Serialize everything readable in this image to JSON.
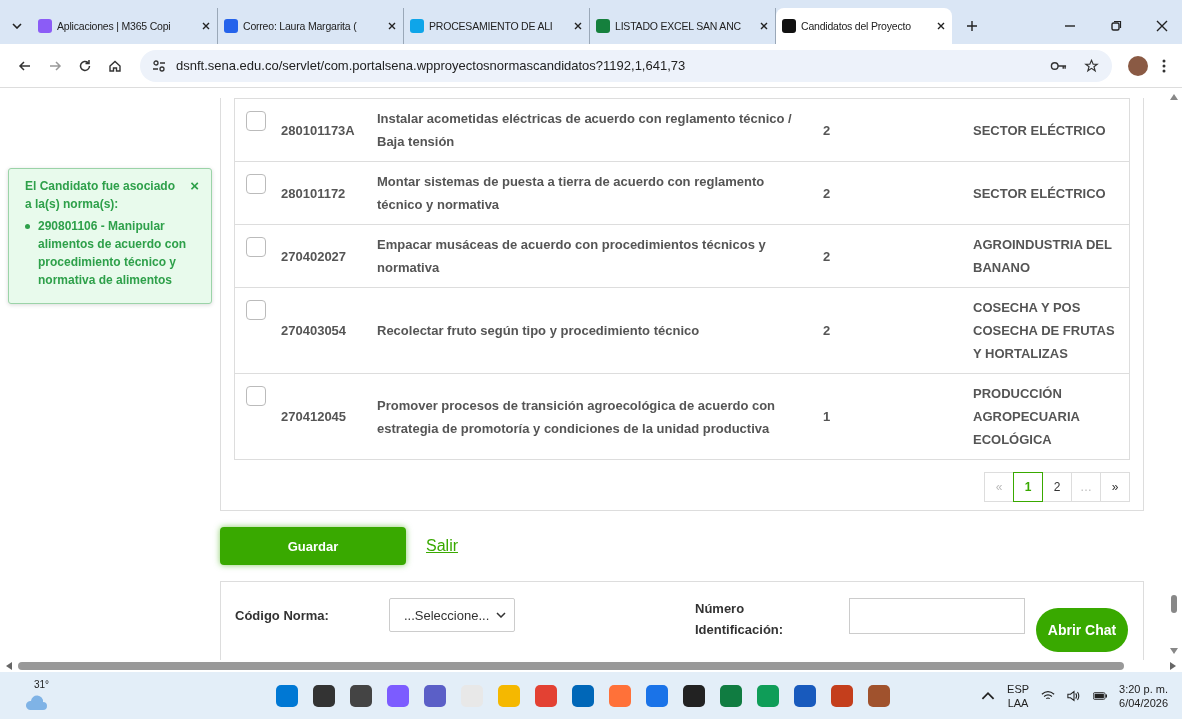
{
  "browser": {
    "tabs": [
      {
        "title": "Aplicaciones | M365 Copi",
        "selected": false
      },
      {
        "title": "Correo: Laura Margarita (",
        "selected": false
      },
      {
        "title": "PROCESAMIENTO DE ALI",
        "selected": false
      },
      {
        "title": "LISTADO EXCEL SAN ANC",
        "selected": false
      },
      {
        "title": "Candidatos del Proyecto",
        "selected": true
      }
    ],
    "url": "dsnft.sena.edu.co/servlet/com.portalsena.wpproyectosnormascandidatos?1192,1,641,73"
  },
  "table": {
    "rows": [
      {
        "checked": false,
        "code": "280101173A",
        "description": "Instalar acometidas eléctricas de acuerdo con reglamento técnico / Baja tensión",
        "number": "2",
        "sector": "SECTOR ELÉCTRICO"
      },
      {
        "checked": false,
        "code": "280101172",
        "description": "Montar sistemas de puesta a tierra de acuerdo con reglamento técnico y normativa",
        "number": "2",
        "sector": "SECTOR ELÉCTRICO"
      },
      {
        "checked": false,
        "code": "270402027",
        "description": "Empacar musáceas de acuerdo con procedimientos técnicos y normativa",
        "number": "2",
        "sector": "AGROINDUSTRIA DEL BANANO"
      },
      {
        "checked": false,
        "code": "270403054",
        "description": "Recolectar fruto según tipo y procedimiento técnico",
        "number": "2",
        "sector": "COSECHA Y POS COSECHA DE FRUTAS Y HORTALIZAS"
      },
      {
        "checked": false,
        "code": "270412045",
        "description": "Promover procesos de transición agroecológica de acuerdo con estrategia de promotoría y condiciones de la unidad productiva",
        "number": "1",
        "sector": "PRODUCCIÓN AGROPECUARIA ECOLÓGICA"
      }
    ],
    "pagination": [
      {
        "label": "«",
        "selected": false,
        "disabled": true
      },
      {
        "label": "1",
        "selected": true,
        "disabled": false
      },
      {
        "label": "2",
        "selected": false,
        "disabled": false
      },
      {
        "label": "…",
        "selected": false,
        "disabled": true
      },
      {
        "label": "»",
        "selected": false,
        "disabled": false
      }
    ]
  },
  "toast": {
    "title": "El Candidato fue asociado a la(s) norma(s):",
    "items": [
      "290801106 - Manipular alimentos de acuerdo con procedimiento técnico y normativa de alimentos"
    ],
    "close": "×"
  },
  "actions": {
    "save": "Guardar",
    "exit": "Salir"
  },
  "filters": {
    "code_label": "Código Norma:",
    "code_select": "...Seleccione...",
    "id_label": "Número Identificación:",
    "chat": "Abrir Chat"
  },
  "taskbar": {
    "weather": "31°",
    "language": "ESP",
    "layout": "LAA",
    "time": "3:20 p. m.",
    "date": "6/04/2026"
  }
}
